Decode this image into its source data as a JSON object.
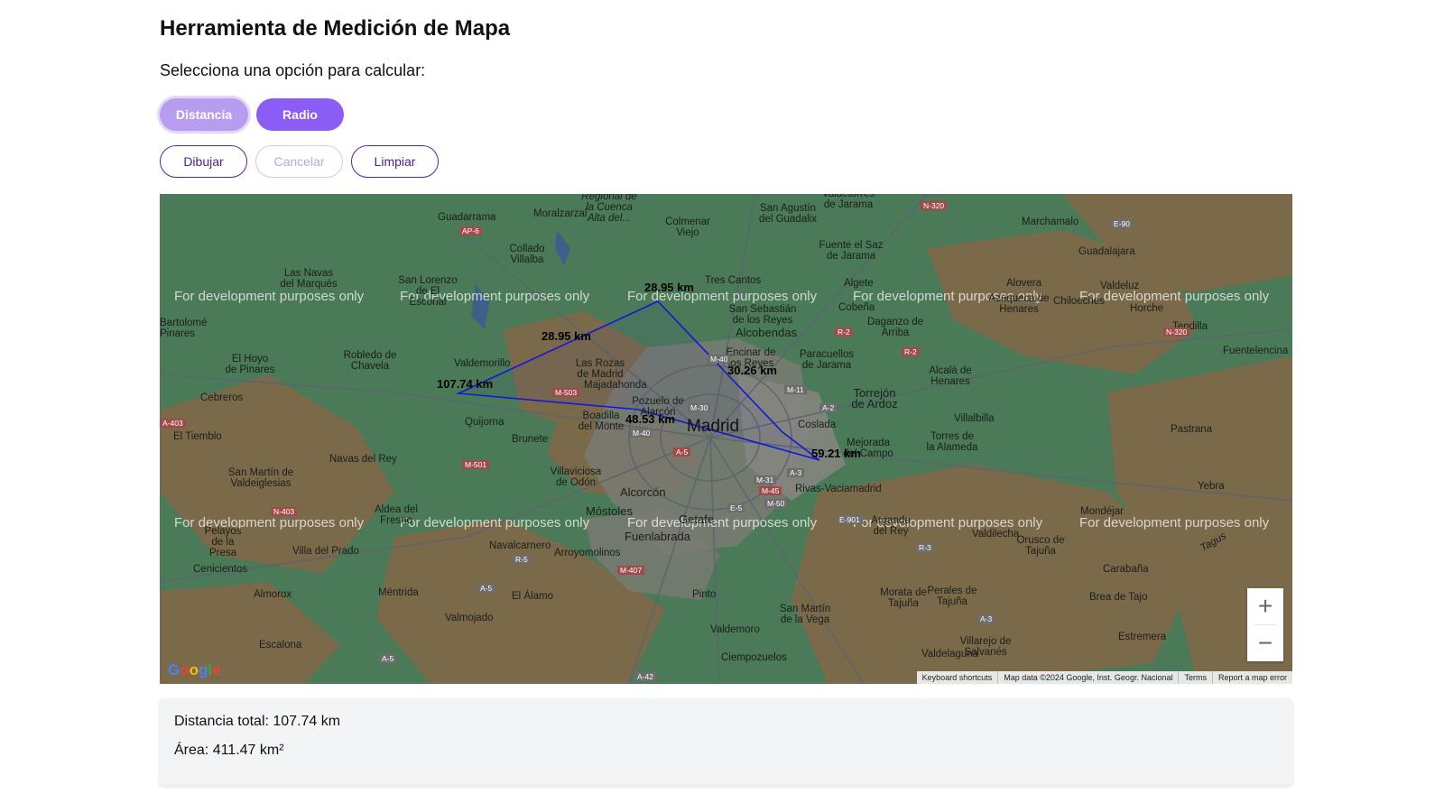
{
  "header": {
    "title": "Herramienta de Medición de Mapa",
    "subtitle": "Selecciona una opción para calcular:"
  },
  "modes": {
    "distance": "Distancia",
    "radius": "Radio",
    "active": "Distancia"
  },
  "actions": {
    "draw": "Dibujar",
    "cancel": "Cancelar",
    "clear": "Limpiar"
  },
  "map": {
    "watermark": "For development purposes only",
    "segment_labels": [
      "107.74 km",
      "28.95 km",
      "28.95 km",
      "30.26 km",
      "48.53 km",
      "59.21 km"
    ],
    "places": [
      "Guadarrama",
      "Moralzarzal",
      "Regional de la Cuenca Alta del...",
      "Colmenar Viejo",
      "San Agustín del Guadalix",
      "Valdetorres de Jarama",
      "Marchamalo",
      "Collado Villalba",
      "Fuente el Saz de Jarama",
      "Guadalajara",
      "Las Navas del Marqués",
      "San Lorenzo de El Escorial",
      "Tres Cantos",
      "Algete",
      "Alovera",
      "Valdeluz",
      "Cobeña",
      "Azuqueca de Henares",
      "Chiloeches",
      "Horche",
      "Bartolomé Pinares",
      "San Sebastián de los Reyes",
      "Daganzo de Arriba",
      "Tendilla",
      "Alcobendas",
      "Valdemorillo",
      "El Hoyo de Pinares",
      "Robledo de Chavela",
      "Las Rozas de Madrid",
      "Encinar de los Reyes",
      "Paracuellos de Jarama",
      "Fuentelencina",
      "Alcalá de Henares",
      "Majadahonda",
      "Cebreros",
      "Pozuelo de Alarcón",
      "Torrejón de Ardoz",
      "Madrid",
      "Boadilla del Monte",
      "Coslada",
      "Quijorna",
      "Villalbilla",
      "El Tiemblo",
      "Brunete",
      "Torres de la Alameda",
      "Pastrana",
      "Mejorada del Campo",
      "Navas del Rey",
      "San Martín de Valdeiglesias",
      "Villaviciosa de Odón",
      "Rivas-Vaciamadrid",
      "Yebra",
      "Alcorcón",
      "Aldea del Fresno",
      "Móstoles",
      "Getafe",
      "Arganda del Rey",
      "Mondéjar",
      "Valdilecha",
      "Fuenlabrada",
      "Villa del Prado",
      "Navalcarnero",
      "Arroyomolinos",
      "Orusco de Tajuña",
      "Pelayos de la Presa",
      "Cenicientos",
      "Carabaña",
      "Méntrida",
      "Pinto",
      "El Álamo",
      "Almorox",
      "Morata de Tajuña",
      "Perales de Tajuña",
      "Brea de Tajo",
      "Valmojado",
      "San Martín de la Vega",
      "Valdemoro",
      "Estremera",
      "Escalona",
      "Villarejo de Salvanés",
      "Valdelaguna",
      "Ciempozuelos",
      "Tagus"
    ],
    "roads": [
      "N-320",
      "AP-6",
      "E-90",
      "N-320",
      "R-2",
      "R-2",
      "M-40",
      "M-11",
      "A-2",
      "A-403",
      "M-503",
      "M-30",
      "M-40",
      "A-5",
      "A-3",
      "M-501",
      "M-31",
      "M-45",
      "M-50",
      "E-5",
      "N-403",
      "E-901",
      "R-5",
      "R-3",
      "M-407",
      "A-5",
      "A-3",
      "A-5",
      "A-42"
    ],
    "zoom_in": "+",
    "zoom_out": "−",
    "attribution": [
      "Keyboard shortcuts",
      "Map data ©2024 Google, Inst. Geogr. Nacional",
      "Terms",
      "Report a map error"
    ],
    "logo": [
      "G",
      "o",
      "o",
      "g",
      "l",
      "e"
    ]
  },
  "results": {
    "total_distance": "Distancia total: 107.74 km",
    "area": "Área: 411.47 km²"
  },
  "colors": {
    "accent": "#8b5cf6",
    "accent_light": "#b89cf0",
    "outline": "#5b21b6",
    "polygon_stroke": "#1616d8",
    "map_green": "#4a7a57",
    "map_brown": "#7b6a4a",
    "urban_grey": "#777777"
  }
}
